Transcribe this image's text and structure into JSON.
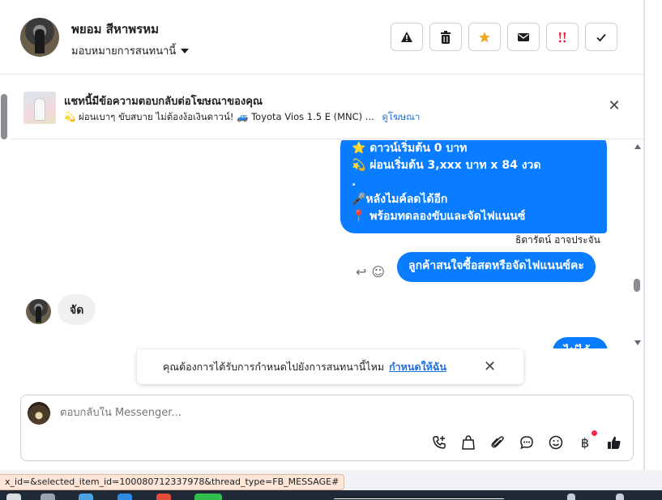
{
  "header": {
    "contact_name": "พยอม สีหาพรหม",
    "assign_label": "มอบหมายการสนทนานี้",
    "actions": [
      {
        "name": "report-icon",
        "glyph": "⚠"
      },
      {
        "name": "trash-icon",
        "glyph": "🗑"
      },
      {
        "name": "star-icon",
        "glyph": "★"
      },
      {
        "name": "mail-icon",
        "glyph": "✉"
      },
      {
        "name": "priority-icon",
        "glyph": "‼"
      },
      {
        "name": "check-icon",
        "glyph": "✓"
      }
    ]
  },
  "ad_banner": {
    "title": "แชทนี้มีข้อความตอบกลับต่อโฆษณาของคุณ",
    "description": "💫 ผ่อนเบาๆ ขับสบาย ไม่ต้องง้อเงินดาวน์! 🚙 Toyota Vios 1.5 E (MNC) ...",
    "link": "ดูโฆษณา"
  },
  "messages": {
    "outgoing_block": [
      "⭐ ดาวน์เริ่มต้น 0 บาท",
      "💫 ผ่อนเริ่มต้น 3,xxx บาท x 84 งวด",
      ".",
      "🎤หลังไมค์ลดได้อีก",
      "📍 พร้อมทดลองขับและจัดไฟแนนซ์"
    ],
    "sender_name": "ธิดารัตน์ อาจประจัน",
    "outgoing_2": "ลูกค้าสนใจซื้อสดหรือจัดไฟแนนซ์คะ",
    "incoming": "จัด",
    "outgoing_3": "ไม่ได้"
  },
  "toast": {
    "text": "คุณต้องการได้รับการกำหนดไปยังการสนทนานี้ไหม",
    "link": "กำหนดให้ฉัน"
  },
  "composer": {
    "placeholder": "ตอบกลับใน Messenger..."
  },
  "status_url": "x_id=&selected_item_id=100080712337978&thread_type=FB_MESSAGE#",
  "colors": {
    "messenger_blue": "#0a7cff",
    "link_blue": "#216fdb",
    "star_orange": "#f5a623",
    "priority_red": "#e41e3f"
  }
}
